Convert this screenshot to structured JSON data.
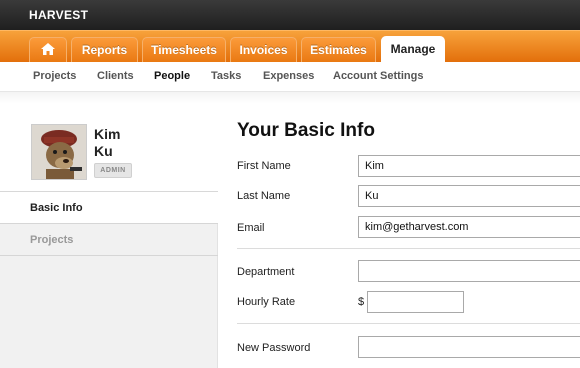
{
  "app": {
    "brand": "HARVEST"
  },
  "tabs": [
    {
      "label": "",
      "icon": "home-icon"
    },
    {
      "label": "Reports"
    },
    {
      "label": "Timesheets"
    },
    {
      "label": "Invoices"
    },
    {
      "label": "Estimates"
    },
    {
      "label": "Manage",
      "active": true
    }
  ],
  "subnav": [
    {
      "label": "Projects"
    },
    {
      "label": "Clients"
    },
    {
      "label": "People",
      "active": true
    },
    {
      "label": "Tasks"
    },
    {
      "label": "Expenses"
    },
    {
      "label": "Account Settings"
    }
  ],
  "profile": {
    "first": "Kim",
    "last": "Ku",
    "role_badge": "ADMIN"
  },
  "sidebar": [
    {
      "label": "Basic Info",
      "active": true
    },
    {
      "label": "Projects"
    }
  ],
  "form": {
    "title": "Your Basic Info",
    "fields": {
      "first_name": {
        "label": "First Name",
        "value": "Kim"
      },
      "last_name": {
        "label": "Last Name",
        "value": "Ku"
      },
      "email": {
        "label": "Email",
        "value": "kim@getharvest.com"
      },
      "department": {
        "label": "Department",
        "value": ""
      },
      "hourly_rate": {
        "label": "Hourly Rate",
        "currency": "$",
        "value": ""
      },
      "new_password": {
        "label": "New Password",
        "value": ""
      }
    }
  },
  "colors": {
    "accent": "#f08a24",
    "topbar": "#262626"
  }
}
